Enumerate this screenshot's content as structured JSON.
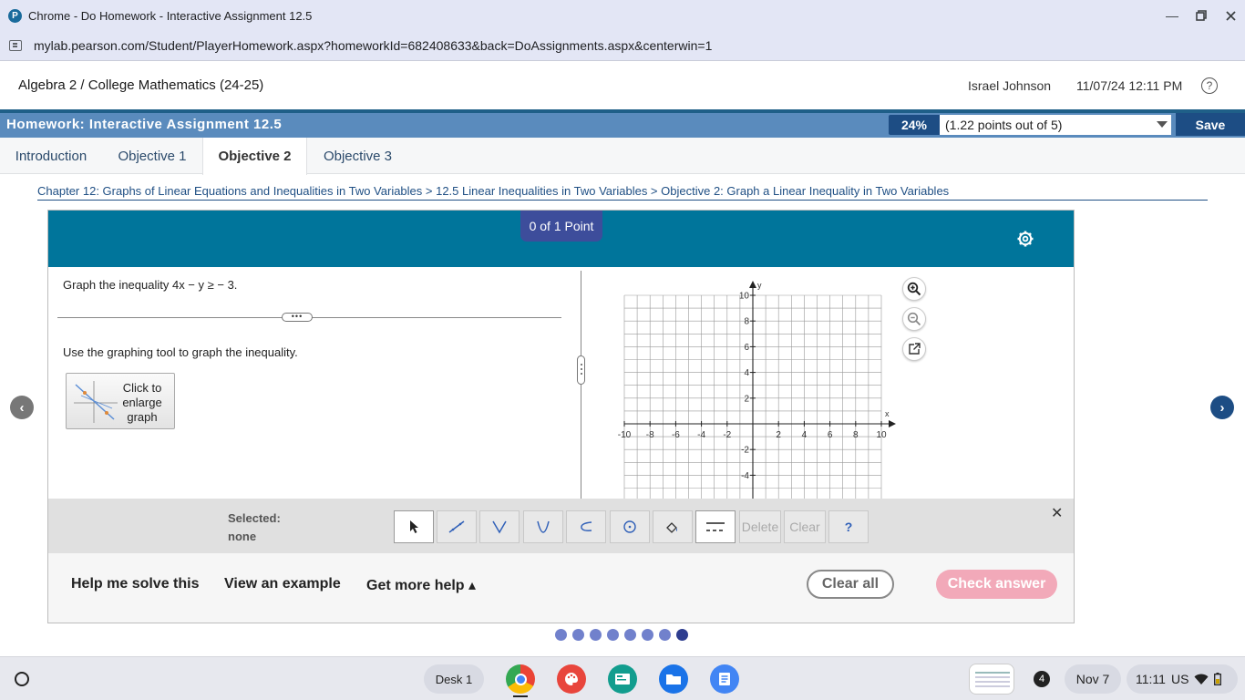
{
  "browser": {
    "title": "Chrome - Do Homework - Interactive Assignment 12.5",
    "url": "mylab.pearson.com/Student/PlayerHomework.aspx?homeworkId=682408633&back=DoAssignments.aspx&centerwin=1",
    "favicon_letter": "P"
  },
  "header": {
    "course": "Algebra 2 / College Mathematics (24-25)",
    "user": "Israel Johnson",
    "datetime": "11/07/24 12:11 PM",
    "help_symbol": "?"
  },
  "homework": {
    "title": "Homework: Interactive Assignment 12.5",
    "percent": "24%",
    "points": "(1.22 points out of 5)",
    "save_label": "Save"
  },
  "tabs": [
    {
      "label": "Introduction",
      "active": false
    },
    {
      "label": "Objective 1",
      "active": false
    },
    {
      "label": "Objective 2",
      "active": true
    },
    {
      "label": "Objective 3",
      "active": false
    }
  ],
  "breadcrumb": "Chapter 12: Graphs of Linear Equations and Inequalities in Two Variables > 12.5 Linear Inequalities in Two Variables > Objective 2: Graph a Linear Inequality in Two Variables",
  "question": {
    "score": "0 of 1 Point",
    "prompt": "Graph the inequality 4x − y ≥ − 3.",
    "instruction": "Use the graphing tool to graph the inequality.",
    "enlarge_label": "Click to enlarge graph",
    "expand_dots": "•••"
  },
  "graph": {
    "x_label": "x",
    "y_label": "y",
    "xlim": [
      -10,
      10
    ],
    "ylim": [
      -4,
      10
    ],
    "x_ticks": [
      "-10",
      "-8",
      "-6",
      "-4",
      "-2",
      "2",
      "4",
      "6",
      "8",
      "10"
    ],
    "y_ticks": [
      "10",
      "8",
      "6",
      "4",
      "2",
      "-2",
      "-4"
    ]
  },
  "toolbar": {
    "selected_label": "Selected:",
    "selected_value": "none",
    "delete_label": "Delete",
    "clear_label": "Clear",
    "help_label": "?",
    "close_symbol": "✕"
  },
  "bottom": {
    "help_solve": "Help me solve this",
    "view_example": "View an example",
    "more_help": "Get more help ▴",
    "clear_all": "Clear all",
    "check_answer": "Check answer"
  },
  "question_dots": {
    "count": 8,
    "current": 8
  },
  "shelf": {
    "desk": "Desk 1",
    "notifications": "4",
    "date": "Nov 7",
    "time": "11:11",
    "locale": "US"
  },
  "colors": {
    "header_teal": "#00759b",
    "score_pill": "#3d4d9b",
    "check_pink": "#f2a9b9",
    "nav_blue": "#1d4d84"
  }
}
